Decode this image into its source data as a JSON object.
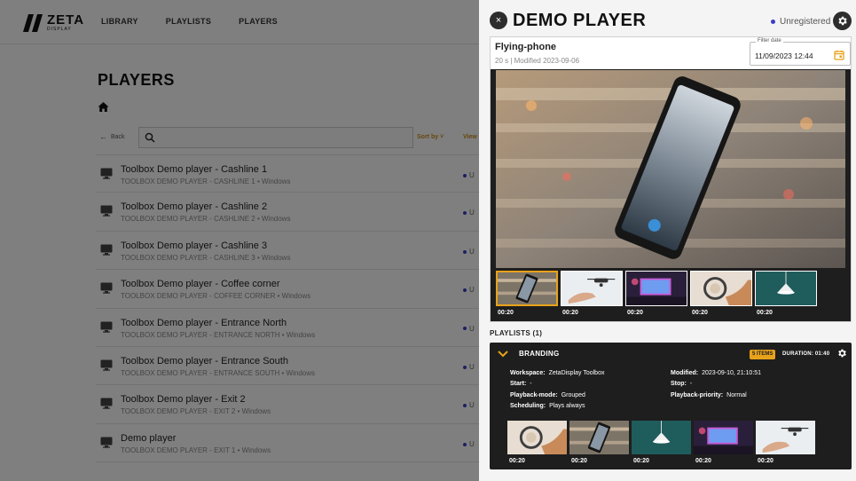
{
  "brand": {
    "logo_big": "ZETA",
    "logo_small": "DISPLAY"
  },
  "nav": [
    {
      "label": "LIBRARY"
    },
    {
      "label": "PLAYLISTS"
    },
    {
      "label": "PLAYERS"
    }
  ],
  "page": {
    "title": "PLAYERS"
  },
  "toolbar": {
    "back_label": "Back",
    "search_value": "",
    "sort_label": "Sort by",
    "view_label": "View"
  },
  "players": [
    {
      "name": "Toolbox Demo player - Cashline 1",
      "sub": "TOOLBOX DEMO PLAYER - CASHLINE 1 • Windows",
      "status": "U"
    },
    {
      "name": "Toolbox Demo player - Cashline 2",
      "sub": "TOOLBOX DEMO PLAYER - CASHLINE 2 • Windows",
      "status": "U"
    },
    {
      "name": "Toolbox Demo player - Cashline 3",
      "sub": "TOOLBOX DEMO PLAYER - CASHLINE 3 • Windows",
      "status": "U"
    },
    {
      "name": "Toolbox Demo player - Coffee corner",
      "sub": "TOOLBOX DEMO PLAYER - COFFEE CORNER • Windows",
      "status": "U"
    },
    {
      "name": "Toolbox Demo player - Entrance North",
      "sub": "TOOLBOX DEMO PLAYER - ENTRANCE NORTH • Windows",
      "status": "U"
    },
    {
      "name": "Toolbox Demo player - Entrance South",
      "sub": "TOOLBOX DEMO PLAYER - ENTRANCE SOUTH • Windows",
      "status": "U"
    },
    {
      "name": "Toolbox Demo player - Exit 2",
      "sub": "TOOLBOX DEMO PLAYER - EXIT 2 • Windows",
      "status": "U"
    },
    {
      "name": "Demo player",
      "sub": "TOOLBOX DEMO PLAYER - EXIT 1 • Windows",
      "status": "U"
    }
  ],
  "panel": {
    "title": "DEMO PLAYER",
    "status": "Unregistered",
    "status_color": "#3b3ec5",
    "close_icon": "×",
    "preview": {
      "media_name": "Flying-phone",
      "media_meta": "20 s | Modified 2023-09-06",
      "filter_label": "Filter date",
      "filter_value": "11/09/2023 12:44",
      "thumbnails": [
        {
          "time": "00:20",
          "selected": true,
          "theme": "phone"
        },
        {
          "time": "00:20",
          "selected": false,
          "theme": "drone"
        },
        {
          "time": "00:20",
          "selected": false,
          "theme": "screen"
        },
        {
          "time": "00:20",
          "selected": false,
          "theme": "headphones"
        },
        {
          "time": "00:20",
          "selected": false,
          "theme": "lamp"
        }
      ]
    },
    "playlists_label": "PLAYLISTS (1)",
    "playlist": {
      "name": "BRANDING",
      "items_badge": "5 ITEMS",
      "duration": "DURATION: 01:40",
      "accent": "#e8a21a",
      "left_info": [
        {
          "k": "Workspace:",
          "v": "ZetaDisplay Toolbox"
        },
        {
          "k": "Start:",
          "v": "-"
        },
        {
          "k": "Playback-mode:",
          "v": "Grouped"
        },
        {
          "k": "Scheduling:",
          "v": "Plays always"
        }
      ],
      "right_info": [
        {
          "k": "Modified:",
          "v": "2023-09-10, 21:10:51"
        },
        {
          "k": "Stop:",
          "v": "-"
        },
        {
          "k": "Playback-priority:",
          "v": "Normal"
        }
      ],
      "thumbnails": [
        {
          "time": "00:20",
          "theme": "headphones"
        },
        {
          "time": "00:20",
          "theme": "phone"
        },
        {
          "time": "00:20",
          "theme": "lamp"
        },
        {
          "time": "00:20",
          "theme": "screen"
        },
        {
          "time": "00:20",
          "theme": "drone"
        }
      ]
    }
  }
}
